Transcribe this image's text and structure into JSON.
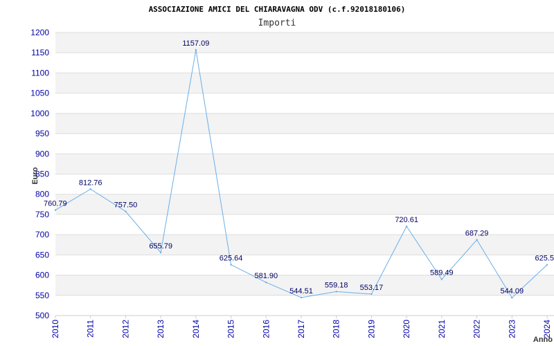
{
  "chart_data": {
    "type": "line",
    "title": "ASSOCIAZIONE AMICI DEL CHIARAVAGNA ODV (c.f.92018180106)",
    "subtitle": "Importi",
    "ylabel": "Euro",
    "xlabel": "Anno",
    "ylim": [
      500,
      1200
    ],
    "yticks": [
      500,
      550,
      600,
      650,
      700,
      750,
      800,
      850,
      900,
      950,
      1000,
      1050,
      1100,
      1150,
      1200
    ],
    "categories": [
      "2010",
      "2011",
      "2012",
      "2013",
      "2014",
      "2015",
      "2016",
      "2017",
      "2018",
      "2019",
      "2020",
      "2021",
      "2022",
      "2023",
      "2024"
    ],
    "values": [
      760.79,
      812.76,
      757.5,
      655.79,
      1157.09,
      625.64,
      581.9,
      544.51,
      559.18,
      553.17,
      720.61,
      589.49,
      687.29,
      544.09,
      625.5
    ],
    "data_labels": [
      "760.79",
      "812.76",
      "757.50",
      "655.79",
      "1157.09",
      "625.64",
      "581.90",
      "544.51",
      "559.18",
      "553.17",
      "720.61",
      "589.49",
      "687.29",
      "544.09",
      "625.5"
    ],
    "grid": true,
    "colors": {
      "line": "#6aaee8",
      "band": "#f3f3f3",
      "tick_text": "#0000aa",
      "label_text": "#000066"
    }
  }
}
